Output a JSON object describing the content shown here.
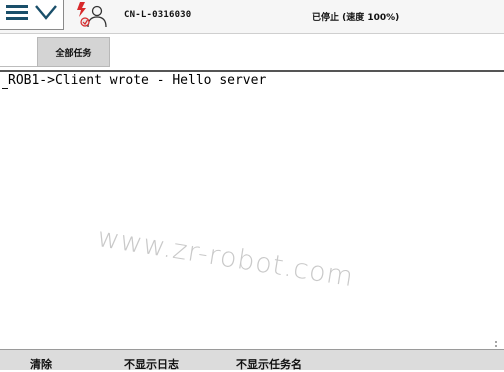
{
  "header": {
    "controller_name": "CN-L-0316030",
    "status": "已停止 (速度 100%)"
  },
  "tabs": [
    {
      "label": "全部任务"
    }
  ],
  "log": {
    "lines": [
      "ROB1->Client wrote - Hello server"
    ]
  },
  "watermark": "www.zr-robot.com",
  "bottom_bar": {
    "clear": "清除",
    "hide_log": "不显示日志",
    "hide_task_name": "不显示任务名"
  },
  "icons": {
    "menu": "hamburger-menu-icon",
    "expand": "chevron-down-icon",
    "robot": "robot-operator-icon"
  },
  "colors": {
    "accent": "#1a4f6a",
    "tab_background": "#d4d4d4",
    "bottom_bar": "#dcdcdc"
  }
}
